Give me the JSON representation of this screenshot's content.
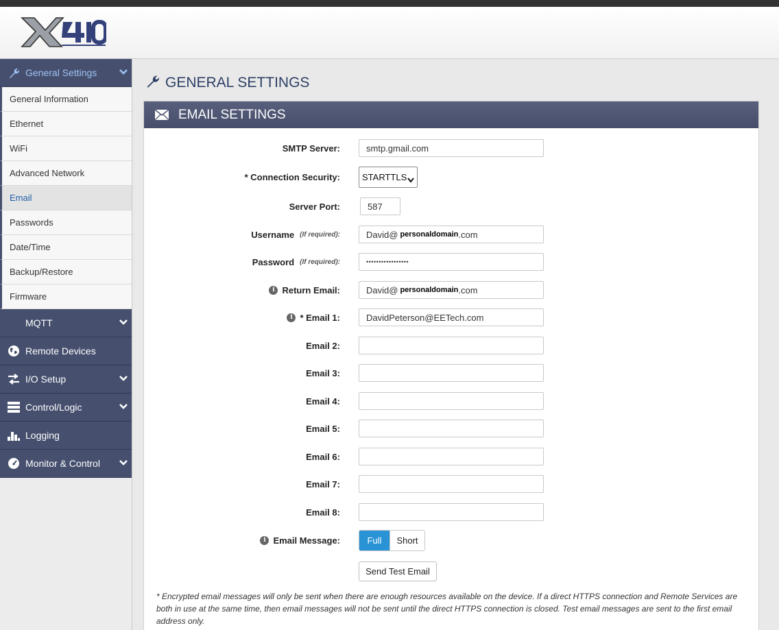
{
  "brand": {
    "logo_text": "X410"
  },
  "sidebar": {
    "general": {
      "label": "General Settings",
      "items": [
        "General Information",
        "Ethernet",
        "WiFi",
        "Advanced Network",
        "Email",
        "Passwords",
        "Date/Time",
        "Backup/Restore",
        "Firmware"
      ],
      "selected": "Email"
    },
    "sections": [
      {
        "label": "MQTT",
        "icon": "none",
        "expandable": true
      },
      {
        "label": "Remote Devices",
        "icon": "globe-icon",
        "expandable": false
      },
      {
        "label": "I/O Setup",
        "icon": "arrows-icon",
        "expandable": true
      },
      {
        "label": "Control/Logic",
        "icon": "server-icon",
        "expandable": true
      },
      {
        "label": "Logging",
        "icon": "bars-icon",
        "expandable": false
      },
      {
        "label": "Monitor & Control",
        "icon": "gauge-icon",
        "expandable": true
      }
    ]
  },
  "page": {
    "title": "GENERAL SETTINGS"
  },
  "panel": {
    "title": "EMAIL SETTINGS"
  },
  "form": {
    "smtp_server": {
      "label": "SMTP Server:",
      "value": "smtp.gmail.com"
    },
    "security": {
      "label": "* Connection Security:",
      "value": "STARTTLS"
    },
    "port": {
      "label": "Server Port:",
      "value": "587"
    },
    "username": {
      "label": "Username",
      "note": "(If required):",
      "value_user": "David@",
      "value_domain": "personaldomain",
      "value_tld": ".com"
    },
    "password": {
      "label": "Password",
      "note": "(If required):",
      "value": "•••••••••••••••••"
    },
    "return_email": {
      "label": "Return Email:",
      "value_user": "David@",
      "value_domain": "personaldomain",
      "value_tld": ".com"
    },
    "email1": {
      "label": "* Email 1:",
      "value": "DavidPeterson@EETech.com"
    },
    "email2": {
      "label": "Email 2:",
      "value": ""
    },
    "email3": {
      "label": "Email 3:",
      "value": ""
    },
    "email4": {
      "label": "Email 4:",
      "value": ""
    },
    "email5": {
      "label": "Email 5:",
      "value": ""
    },
    "email6": {
      "label": "Email 6:",
      "value": ""
    },
    "email7": {
      "label": "Email 7:",
      "value": ""
    },
    "email8": {
      "label": "Email 8:",
      "value": ""
    },
    "message": {
      "label": "Email Message:",
      "option_full": "Full",
      "option_short": "Short",
      "selected": "Full"
    },
    "send_test": "Send Test Email"
  },
  "footnote": "* Encrypted email messages will only be sent when there are enough resources available on the device. If a direct HTTPS connection and Remote Services are both in use at the same time, then email messages will not be sent until the direct HTTPS connection is closed. Test email messages are sent to the first email address only.",
  "colors": {
    "nav_bg": "#46506e",
    "nav_active_text": "#9ec1f3",
    "toggle_on": "#2a93d5",
    "title": "#2c3e64"
  }
}
